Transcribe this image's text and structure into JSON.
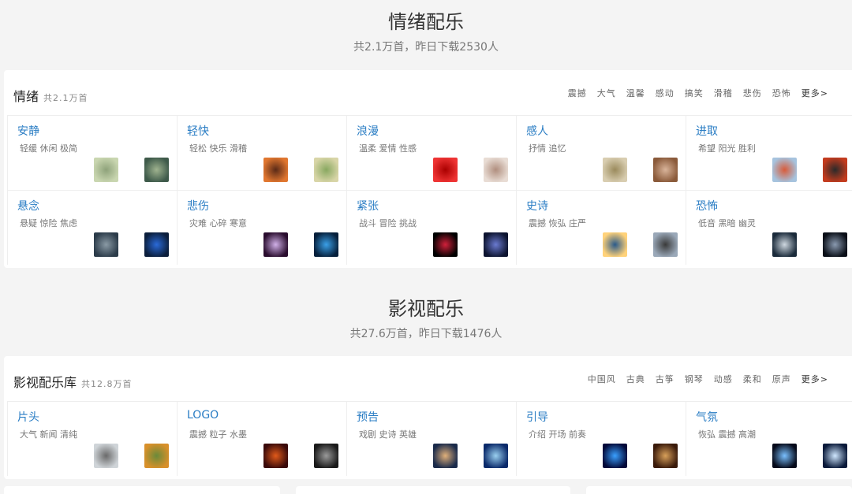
{
  "sections": [
    {
      "title": "情绪配乐",
      "subtitle": "共2.1万首，昨日下载2530人",
      "panel": {
        "title": "情绪",
        "count": "共2.1万首",
        "tags": [
          "震撼",
          "大气",
          "温馨",
          "感动",
          "搞笑",
          "滑稽",
          "悲伤",
          "恐怖"
        ],
        "more": "更多>",
        "cells": [
          {
            "name": "安静",
            "tags": "轻缓 休闲 极简",
            "thumbs": [
              "#c9d6b0,#8ea27a",
              "#3e5a4a,#9fb38f"
            ]
          },
          {
            "name": "轻快",
            "tags": "轻松 快乐 滑稽",
            "thumbs": [
              "#e0762f,#5a2a17",
              "#d8d5a7,#88a860"
            ]
          },
          {
            "name": "浪漫",
            "tags": "温柔 爱情 性感",
            "thumbs": [
              "#e33,#a00",
              "#e8dcd4,#b08e7e"
            ]
          },
          {
            "name": "感人",
            "tags": "抒情 追忆",
            "thumbs": [
              "#d8cdb0,#9a8a5c",
              "#8a5a3a,#d9b49a"
            ]
          },
          {
            "name": "进取",
            "tags": "希望 阳光 胜利",
            "thumbs": [
              "#a6c3de,#d85b3a",
              "#c33b1e,#2a2a2a"
            ]
          },
          {
            "name": "悬念",
            "tags": "悬疑 惊险 焦虑",
            "thumbs": [
              "#2c3c4a,#8a9aa5",
              "#0b1e3c,#2a6ad8"
            ]
          },
          {
            "name": "悲伤",
            "tags": "灾难 心碎 寒意",
            "thumbs": [
              "#2a0d2e,#d0b0e8",
              "#06203c,#3aa0e8"
            ]
          },
          {
            "name": "紧张",
            "tags": "战斗 冒险 挑战",
            "thumbs": [
              "#000,#d0203a",
              "#0d1430,#6a7ad0"
            ]
          },
          {
            "name": "史诗",
            "tags": "震撼 恢弘 庄严",
            "thumbs": [
              "#ffd27a,#2a5a8a",
              "#9aa8b8,#3a3a3a"
            ]
          },
          {
            "name": "恐怖",
            "tags": "低音 黑暗 幽灵",
            "thumbs": [
              "#1a2a3a,#cfd8e0",
              "#0a0f18,#8a9ab0"
            ]
          }
        ]
      }
    },
    {
      "title": "影视配乐",
      "subtitle": "共27.6万首，昨日下载1476人",
      "panel": {
        "title": "影视配乐库",
        "count": "共12.8万首",
        "tags": [
          "中国风",
          "古典",
          "古筝",
          "钢琴",
          "动感",
          "柔和",
          "原声"
        ],
        "more": "更多>",
        "cells": [
          {
            "name": "片头",
            "tags": "大气 新闻 清纯",
            "thumbs": [
              "#cfd4d8,#6a6a6a",
              "#d8902a,#6a8a3a"
            ]
          },
          {
            "name": "LOGO",
            "tags": "震撼 粒子 水墨",
            "thumbs": [
              "#3a0a0a,#e05a1a",
              "#1a1a1a,#9a9a9a"
            ]
          },
          {
            "name": "预告",
            "tags": "戏剧 史诗 英雄",
            "thumbs": [
              "#1a2a4a,#e0b07a",
              "#0a2a6a,#9ad0f0"
            ]
          },
          {
            "name": "引导",
            "tags": "介绍 开场 前奏",
            "thumbs": [
              "#020a3a,#3aa0ff",
              "#3a1a0a,#d8a05a"
            ]
          },
          {
            "name": "气氛",
            "tags": "恢弘 震撼 高潮",
            "thumbs": [
              "#050a1a,#7ac0ff",
              "#0a1a3a,#d0e8ff"
            ]
          }
        ]
      }
    }
  ]
}
